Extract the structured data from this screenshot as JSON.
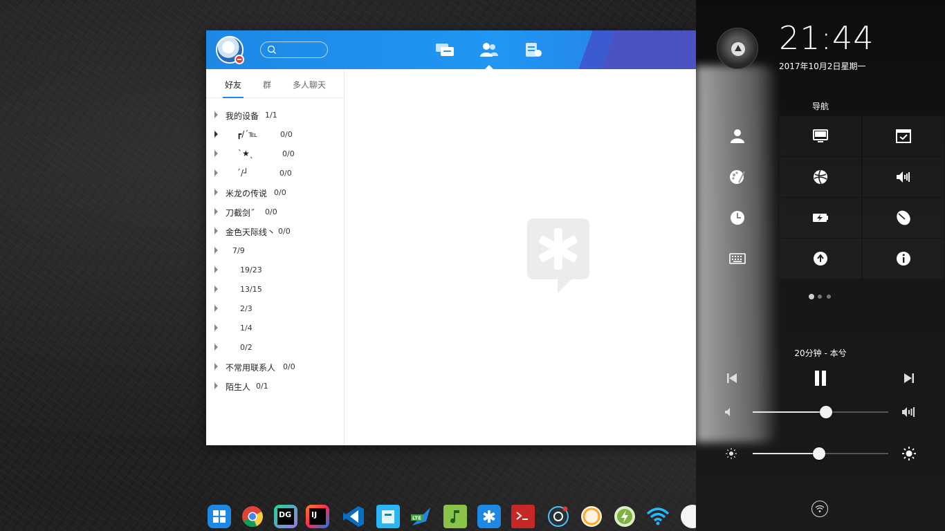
{
  "chat": {
    "search": {
      "placeholder": "",
      "value": ""
    },
    "header_tabs": [
      "messages",
      "contacts",
      "files"
    ],
    "sub_tabs": [
      {
        "label": "好友",
        "active": true
      },
      {
        "label": "群",
        "active": false
      },
      {
        "label": "多人聊天",
        "active": false
      }
    ],
    "groups": [
      {
        "name": "我的设备",
        "count": "1/1"
      },
      {
        "name": "┏/ˊ℡",
        "count": "0/0"
      },
      {
        "name": "ˋ★ˎ",
        "count": "0/0"
      },
      {
        "name": "ˊ/┘",
        "count": "0/0"
      },
      {
        "name": "米龙の传说",
        "count": "0/0"
      },
      {
        "name": "刀截剑˝",
        "count": "0/0"
      },
      {
        "name": "金色天际线丶",
        "count": "0/0"
      },
      {
        "name": "",
        "count": "7/9"
      },
      {
        "name": "",
        "count": "19/23"
      },
      {
        "name": "",
        "count": "13/15"
      },
      {
        "name": "",
        "count": "2/3"
      },
      {
        "name": "",
        "count": "1/4"
      },
      {
        "name": "",
        "count": "0/2"
      },
      {
        "name": "不常用联系人",
        "count": "0/0"
      },
      {
        "name": "陌生人",
        "count": "0/1"
      }
    ],
    "accent": "#1e88e5"
  },
  "panel": {
    "time": "21:44",
    "date": "2017年10月2日星期一",
    "nav_title": "导航",
    "nav_icons": [
      "account-icon",
      "display-icon",
      "default-apps-icon",
      "personalization-icon",
      "network-icon",
      "sound-icon",
      "time-icon",
      "power-icon",
      "mouse-icon",
      "keyboard-icon",
      "update-icon",
      "info-icon"
    ],
    "page_count": 3,
    "page_active": 1,
    "song": "20分钟 - 本兮",
    "volume_level": 0.54,
    "brightness_level": 0.49
  },
  "dock": {
    "apps": [
      "launcher-icon",
      "chrome-icon",
      "datagrip-icon",
      "intellij-icon",
      "vscode-icon",
      "file-manager-icon",
      "lte-icon",
      "music-icon",
      "chat-app-icon",
      "terminal-icon",
      "screenshot-icon",
      "clock-app-icon",
      "power-app-icon",
      "wifi-icon",
      "calendar-icon"
    ]
  }
}
